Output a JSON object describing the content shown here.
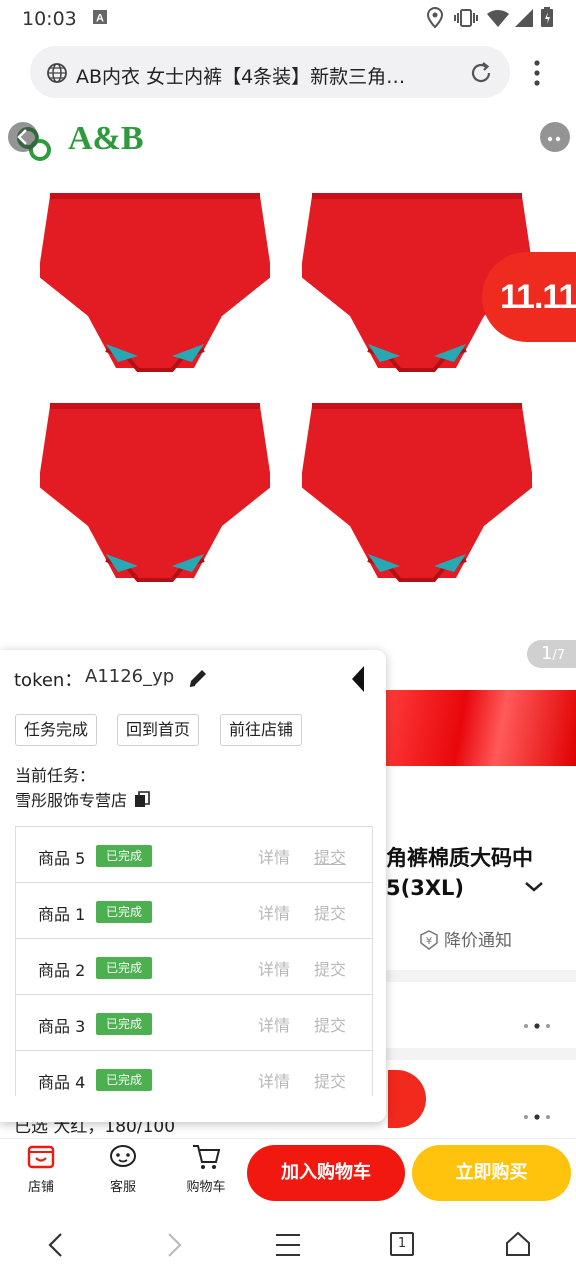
{
  "status_bar": {
    "time": "10:03"
  },
  "browser": {
    "url_title": "AB内衣 女士内裤【4条装】新款三角…"
  },
  "product": {
    "brand_logo": "A&B",
    "promo_badge": "11.11",
    "image_counter_current": "1",
    "image_counter_total": "/7",
    "title_line1": "角裤棉质大码中",
    "title_line2": "5(3XL)",
    "price_notify": "降价通知",
    "spec_partial": "已选  大红，180/100"
  },
  "panel": {
    "token_label": "token：",
    "token_value": "A1126_yp",
    "buttons": [
      "任务完成",
      "回到首页",
      "前往店铺"
    ],
    "current_task_label": "当前任务：",
    "current_task_value": "雪彤服饰专营店",
    "tasks": [
      {
        "name": "商品 5",
        "status": "已完成",
        "detail": "详情",
        "submit": "提交"
      },
      {
        "name": "商品 1",
        "status": "已完成",
        "detail": "详情",
        "submit": "提交"
      },
      {
        "name": "商品 2",
        "status": "已完成",
        "detail": "详情",
        "submit": "提交"
      },
      {
        "name": "商品 3",
        "status": "已完成",
        "detail": "详情",
        "submit": "提交"
      },
      {
        "name": "商品 4",
        "status": "已完成",
        "detail": "详情",
        "submit": "提交"
      }
    ]
  },
  "action_bar": {
    "shop": "店铺",
    "service": "客服",
    "cart": "购物车",
    "add_to_cart": "加入购物车",
    "buy_now": "立即购买"
  },
  "nav": {
    "tab_count": "1"
  },
  "colors": {
    "accent_red": "#f0180f",
    "buy_yellow": "#ffc20d",
    "done_green": "#4caf50",
    "product_red": "#e31b23"
  }
}
